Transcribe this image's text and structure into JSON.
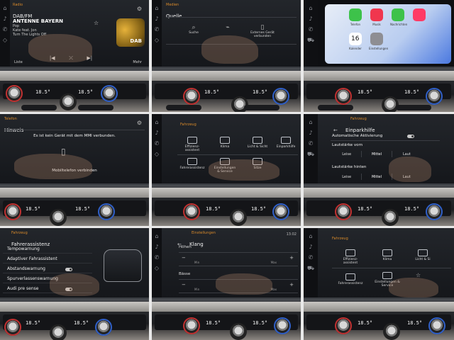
{
  "tiles": {
    "radio": {
      "category": "Radio",
      "title": "DAB/FM",
      "station": "ANTENNE BAYERN",
      "genre": "Pop",
      "artist": "Kate feat. Jon",
      "song": "Turn The Lights Off",
      "badge": "DAB",
      "left_label": "Liste",
      "right_label": "Mehr",
      "icon_star": "star-icon",
      "icon_gear": "gear-icon"
    },
    "medien": {
      "category": "Medien",
      "title": "Quelle",
      "items": [
        "Suche",
        "",
        "Externes Gerät verbunden"
      ]
    },
    "carplay": {
      "apps": [
        {
          "label": "Telefon",
          "color": "#3dc24a"
        },
        {
          "label": "Musik",
          "color": "#f0364e"
        },
        {
          "label": "Nachrichten",
          "color": "#3dc24a"
        },
        {
          "label": "",
          "color": "#ff3b66"
        },
        {
          "label": "",
          "color": "#ffffff"
        },
        {
          "label": "Kalender",
          "color": "#ffffff"
        },
        {
          "label": "Einstellungen",
          "color": "#8e8e93"
        }
      ],
      "calendar_day": "16"
    },
    "hinweis": {
      "category": "Telefon",
      "title": "Hinweis",
      "message": "Es ist kein Gerät mit dem MMI verbunden.",
      "action": "Mobiltelefon verbinden"
    },
    "fahrzeug": {
      "category": "Fahrzeug",
      "items": [
        "Effizienz-assistent",
        "Klima",
        "Licht & Sicht",
        "Einparkhilfe",
        "Fahrerassistenz",
        "Einstellungen & Service",
        "Sitze"
      ]
    },
    "einparkhilfe": {
      "category": "Fahrzeug",
      "title": "Einparkhilfe",
      "auto_label": "Automatische Aktivierung",
      "front_label": "Lautstärke vorn",
      "rear_label": "Lautstärke hinten",
      "levels": [
        "Leise",
        "Mittel",
        "Laut"
      ]
    },
    "fahrerassistenz": {
      "category": "Fahrzeug",
      "title": "Fahrerassistenz",
      "items": [
        "Tempowarnung",
        "Adaptiver Fahrassistent",
        "Abstandswarnung",
        "Spurverlassenswarnung",
        "Audi pre sense"
      ]
    },
    "klang": {
      "category": "Einstellungen",
      "title": "Klang",
      "hoehen": "Höhen",
      "baesse": "Bässe",
      "min": "Min",
      "max": "Max",
      "minus": "−",
      "plus": "+",
      "time": "13:02"
    },
    "fahrzeug2": {
      "category": "Fahrzeug",
      "items": [
        "Effizienz-assistent",
        "Klima",
        "Licht & Si",
        "Fahrerassistenz",
        "Einstellungen & Service"
      ]
    }
  },
  "climate": {
    "temp_left": "18.5°",
    "temp_right": "18.5°"
  },
  "colors": {
    "accent": "#d98a2a",
    "screen_bg": "#1a1c20",
    "radio_glow": "#e6b23a"
  }
}
